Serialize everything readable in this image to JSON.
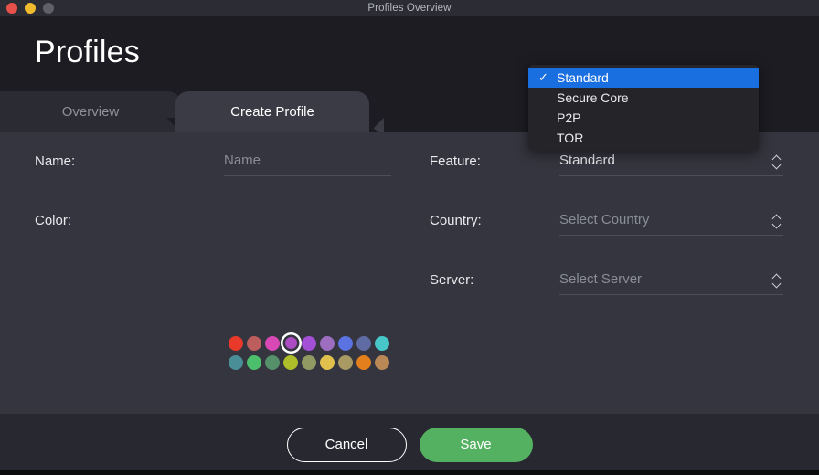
{
  "window": {
    "title": "Profiles Overview",
    "traffic_lights": [
      "close",
      "minimize",
      "zoom"
    ]
  },
  "header": {
    "page_title": "Profiles"
  },
  "tabs": [
    {
      "label": "Overview",
      "active": false
    },
    {
      "label": "Create Profile",
      "active": true
    }
  ],
  "form": {
    "left": {
      "name": {
        "label": "Name:",
        "value": "",
        "placeholder": "Name"
      },
      "color": {
        "label": "Color:",
        "selected_index": 3
      }
    },
    "right": {
      "feature": {
        "label": "Feature:",
        "value": "Standard",
        "placeholder": ""
      },
      "country": {
        "label": "Country:",
        "value": "",
        "placeholder": "Select Country"
      },
      "server": {
        "label": "Server:",
        "value": "",
        "placeholder": "Select Server"
      }
    }
  },
  "color_palette": [
    "#e8392a",
    "#bd5e5e",
    "#d849b6",
    "#ab4cc4",
    "#a34fd6",
    "#9d6dbf",
    "#5a73e0",
    "#5f6ba3",
    "#47c7c8",
    "#4a8f97",
    "#4cbf6d",
    "#55906b",
    "#adbe2a",
    "#929a63",
    "#e2c04e",
    "#a89a62",
    "#e3801d",
    "#b98856"
  ],
  "feature_menu": {
    "open": true,
    "items": [
      {
        "label": "Standard",
        "checked": true,
        "highlighted": true
      },
      {
        "label": "Secure Core",
        "checked": false,
        "highlighted": false
      },
      {
        "label": "P2P",
        "checked": false,
        "highlighted": false
      },
      {
        "label": "TOR",
        "checked": false,
        "highlighted": false
      }
    ],
    "check_glyph": "✓"
  },
  "footer": {
    "cancel_label": "Cancel",
    "save_label": "Save",
    "save_color": "#55b162"
  }
}
